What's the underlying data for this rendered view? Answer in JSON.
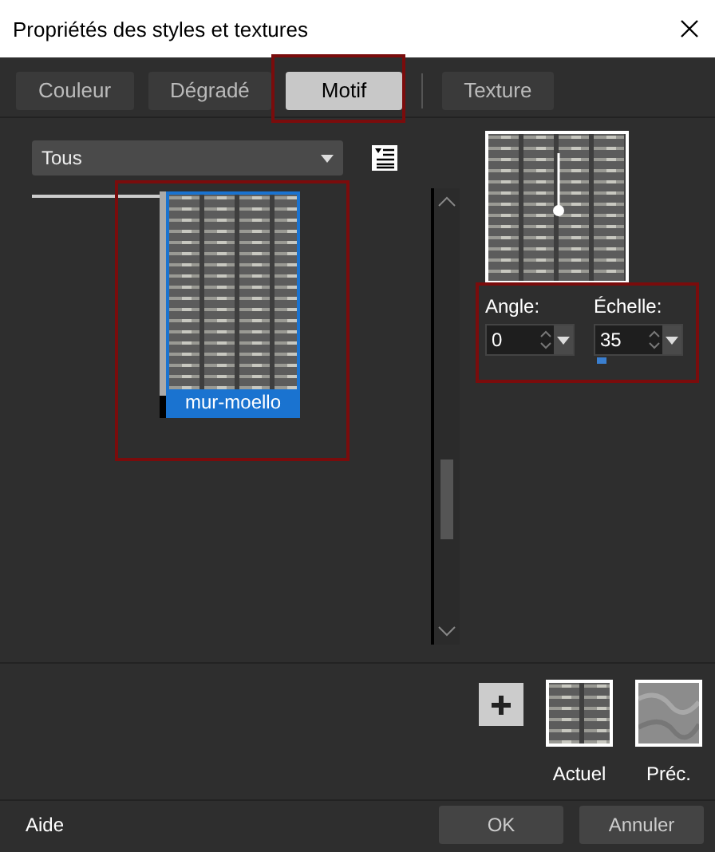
{
  "window": {
    "title": "Propriétés des styles et textures"
  },
  "tabs": [
    {
      "label": "Couleur",
      "selected": false
    },
    {
      "label": "Dégradé",
      "selected": false
    },
    {
      "label": "Motif",
      "selected": true
    },
    {
      "label": "Texture",
      "selected": false
    }
  ],
  "category": {
    "value": "Tous"
  },
  "patterns": [
    {
      "name": "mur-moello",
      "selected": true
    }
  ],
  "fields": [
    {
      "label": "Angle:",
      "value": "0"
    },
    {
      "label": "Échelle:",
      "value": "35",
      "level": 0.03
    }
  ],
  "swatches": [
    {
      "label": "Actuel",
      "kind": "stripes"
    },
    {
      "label": "Préc.",
      "kind": "marble"
    }
  ],
  "buttons": {
    "help": "Aide",
    "ok": "OK",
    "cancel": "Annuler"
  }
}
